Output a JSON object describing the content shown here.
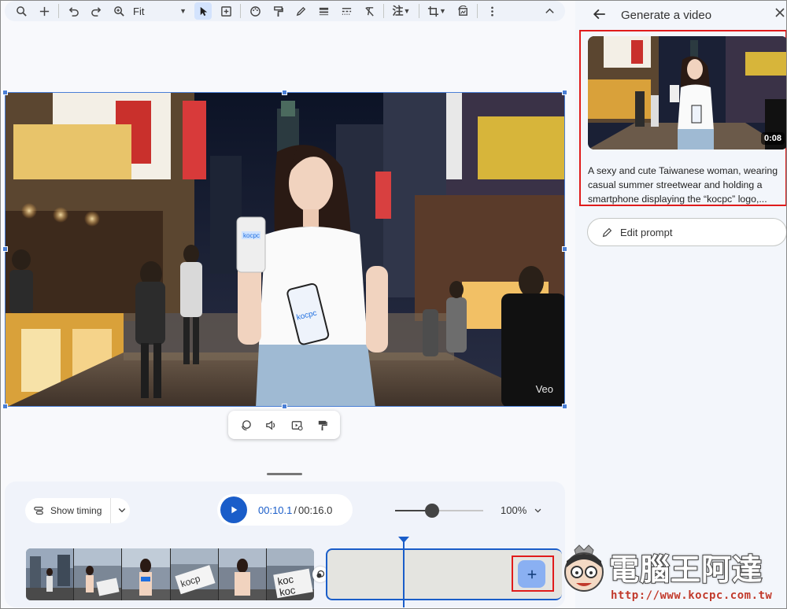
{
  "toolbar": {
    "zoom_label": "Fit",
    "icons": [
      "search-icon",
      "add-icon",
      "undo-icon",
      "redo-icon",
      "zoom-icon",
      "pointer-icon",
      "add-text-box-icon",
      "palette-icon",
      "paint-format-icon",
      "pen-icon",
      "line-weight-icon",
      "line-dash-icon",
      "clear-format-icon",
      "annotate-icon",
      "crop-icon",
      "replace-image-icon",
      "more-icon",
      "collapse-icon"
    ]
  },
  "canvas": {
    "video_watermark": "Veo",
    "floating_tools": [
      "animate-icon",
      "volume-icon",
      "video-settings-icon",
      "paint-roller-icon"
    ]
  },
  "timeline": {
    "show_timing_label": "Show timing",
    "current_time": "00:10.1",
    "separator": "/",
    "total_time": "00:16.0",
    "zoom_percent": "100%",
    "zoom_fraction": 0.42
  },
  "right_panel": {
    "title": "Generate a video",
    "duration": "0:08",
    "prompt": "A sexy and cute Taiwanese woman, wearing casual summer streetwear and holding a smartphone displaying the “kocpc” logo,...",
    "edit_prompt_label": "Edit prompt"
  },
  "watermark": {
    "brand": "電腦王阿達",
    "url": "http://www.kocpc.com.tw"
  },
  "colors": {
    "accent": "#1a5dc9",
    "highlight": "#e01b1b"
  }
}
